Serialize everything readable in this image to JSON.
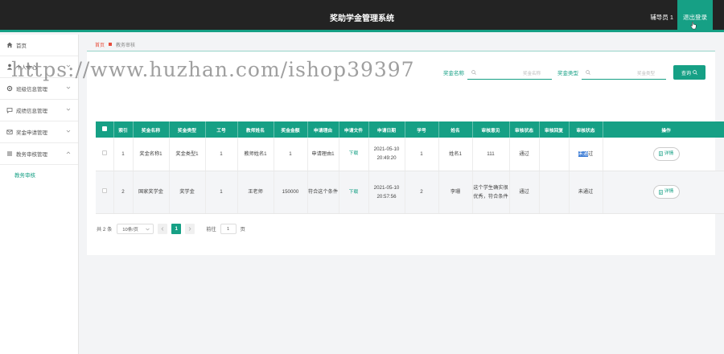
{
  "header": {
    "title": "奖助学金管理系统",
    "user": "辅导员 1",
    "logout_label": "退出登录",
    "accent": "#16a085"
  },
  "sidebar": {
    "items": [
      {
        "label": "首页",
        "icon": "home-icon"
      },
      {
        "label": "个人中心",
        "icon": "user-icon"
      },
      {
        "label": "班级信息管理",
        "icon": "gear-icon"
      },
      {
        "label": "成绩信息管理",
        "icon": "chat-icon"
      },
      {
        "label": "奖金申请管理",
        "icon": "mail-icon"
      },
      {
        "label": "教务审核管理",
        "icon": "list-icon"
      }
    ],
    "sub_item": "教务审核"
  },
  "breadcrumb": {
    "home": "首页",
    "current": "教务审核"
  },
  "search": {
    "label1": "奖金名称",
    "placeholder1": "奖金名称",
    "label2": "奖金类型",
    "placeholder2": "奖金类型",
    "button": "查询"
  },
  "table": {
    "headers": [
      "索引",
      "奖金名称",
      "奖金类型",
      "工号",
      "教师姓名",
      "奖金金额",
      "申请理由",
      "申请文件",
      "申请日期",
      "学号",
      "姓名",
      "审核意见",
      "审核状态",
      "审核回复",
      "审核状态",
      "操作"
    ],
    "rows": [
      {
        "index": "1",
        "name": "奖金名称1",
        "type": "奖金类型1",
        "work_no": "1",
        "teacher": "教师姓名1",
        "amount": "1",
        "reason": "申请理由1",
        "file": "下载",
        "date": "2021-05-10 20:49:20",
        "student_no": "1",
        "student": "姓名1",
        "opinion": "111",
        "status": "通过",
        "reply": "",
        "review_status_a": "未通",
        "review_status_b": "过",
        "action": "详情"
      },
      {
        "index": "2",
        "name": "国家奖学金",
        "type": "奖学金",
        "work_no": "1",
        "teacher": "王老师",
        "amount": "150000",
        "reason": "符合这个条件",
        "file": "下载",
        "date": "2021-05-10 20:57:56",
        "student_no": "2",
        "student": "李珊",
        "opinion": "这个学生确实很优秀，符合条件",
        "status": "通过",
        "reply": "",
        "review_status": "未通过",
        "action": "详情"
      }
    ]
  },
  "pager": {
    "total": "共 2 条",
    "page_size": "10条/页",
    "current_page": "1",
    "goto_label": "前往",
    "goto_value": "1",
    "page_unit": "页"
  },
  "watermark": "https://www.huzhan.com/ishop39397"
}
